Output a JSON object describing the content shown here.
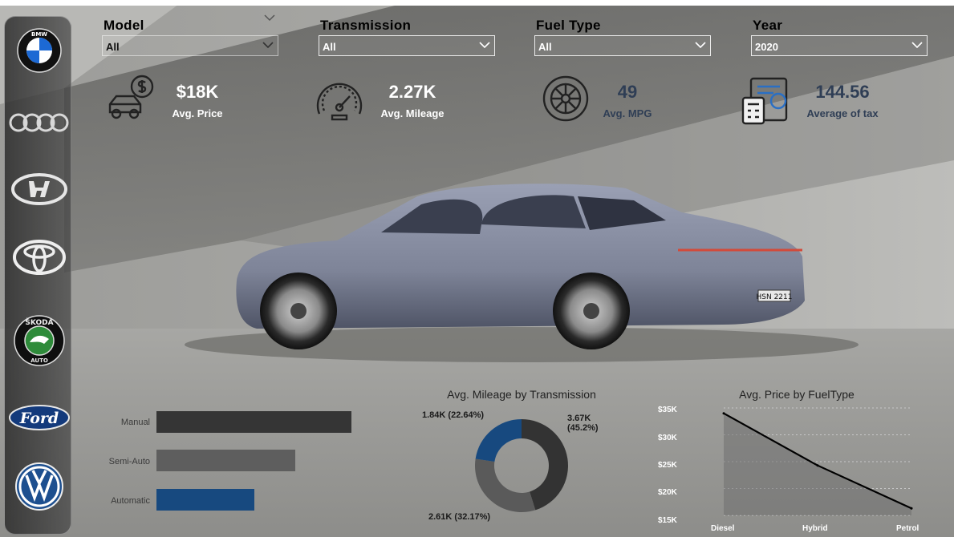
{
  "sidebar": {
    "brands": [
      {
        "name": "BMW",
        "icon": "bmw-logo"
      },
      {
        "name": "Audi",
        "icon": "audi-logo"
      },
      {
        "name": "Hyundai",
        "icon": "hyundai-logo"
      },
      {
        "name": "Toyota",
        "icon": "toyota-logo"
      },
      {
        "name": "Skoda",
        "icon": "skoda-logo",
        "text_top": "ŠKODA",
        "text_bottom": "AUTO"
      },
      {
        "name": "Ford",
        "icon": "ford-logo",
        "text": "Ford"
      },
      {
        "name": "Volkswagen",
        "icon": "vw-logo"
      }
    ]
  },
  "filters": {
    "model": {
      "label": "Model",
      "value": "All"
    },
    "transmission": {
      "label": "Transmission",
      "value": "All"
    },
    "fuel_type": {
      "label": "Fuel Type",
      "value": "All"
    },
    "year": {
      "label": "Year",
      "value": "2020"
    }
  },
  "kpis": {
    "price": {
      "value": "$18K",
      "label": "Avg. Price",
      "icon": "car-price-icon"
    },
    "mileage": {
      "value": "2.27K",
      "label": "Avg. Mileage",
      "icon": "speedometer-icon"
    },
    "mpg": {
      "value": "49",
      "label": "Avg. MPG",
      "icon": "tire-icon"
    },
    "tax": {
      "value": "144.56",
      "label": "Average of tax",
      "icon": "tax-calculator-icon"
    }
  },
  "hero": {
    "plate": "HSN 2211",
    "icon": "sedan-car-image"
  },
  "colors": {
    "dark_bar": "#353535",
    "gray_bar": "#5e5e5e",
    "blue": "#17497f",
    "donut_gray": "#5a5a5a",
    "donut_dark": "#333333"
  },
  "chart_data": [
    {
      "type": "bar",
      "title": "",
      "categories": [
        "Manual",
        "Semi-Auto",
        "Automatic"
      ],
      "values": [
        3.67,
        2.61,
        1.84
      ],
      "xlabel": "",
      "ylabel": ""
    },
    {
      "type": "pie",
      "title": "Avg. Mileage by Transmission",
      "categories": [
        "Manual",
        "Semi-Auto",
        "Automatic"
      ],
      "values": [
        3.67,
        2.61,
        1.84
      ],
      "data_labels": [
        "3.67K (45.2%)",
        "2.61K (32.17%)",
        "1.84K (22.64%)"
      ]
    },
    {
      "type": "area",
      "title": "Avg. Price by FuelType",
      "categories": [
        "Diesel",
        "Hybrid",
        "Petrol"
      ],
      "values": [
        34.0,
        24.3,
        16.3
      ],
      "yticks": [
        "$35K",
        "$30K",
        "$25K",
        "$20K",
        "$15K"
      ],
      "ylim": [
        15,
        35
      ]
    }
  ]
}
